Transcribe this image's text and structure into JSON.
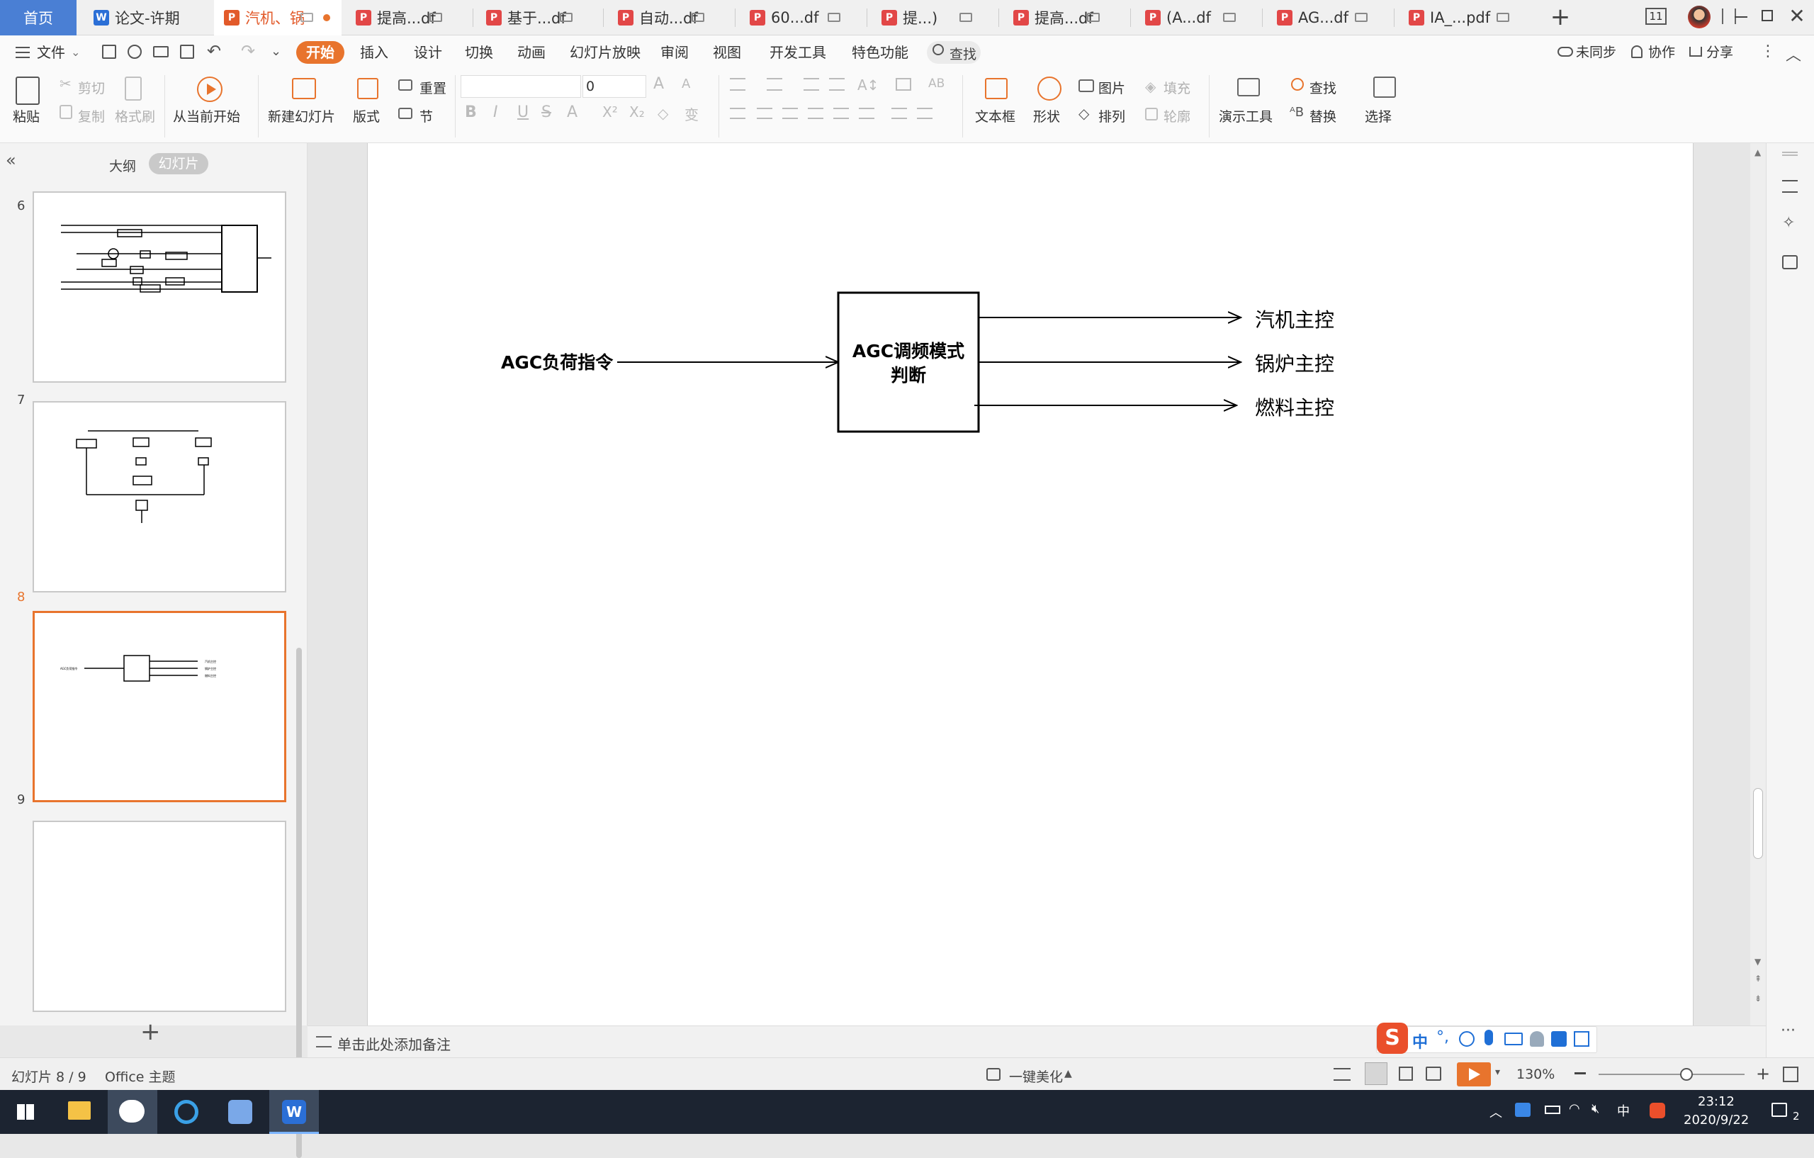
{
  "tabs": [
    {
      "label": "首页",
      "icon": "home",
      "active": false
    },
    {
      "label": "论文-许期",
      "icon": "word-doc-icon"
    },
    {
      "label": "汽机、锅",
      "icon": "ppt-icon",
      "active": true
    },
    {
      "label": "提高...df",
      "icon": "pdf-icon"
    },
    {
      "label": "基于...df",
      "icon": "pdf-icon"
    },
    {
      "label": "自动...df",
      "icon": "pdf-icon"
    },
    {
      "label": "60...df",
      "icon": "pdf-icon"
    },
    {
      "label": "提...)",
      "icon": "pdf-icon"
    },
    {
      "label": "提高...df",
      "icon": "pdf-icon"
    },
    {
      "label": "(A...df",
      "icon": "pdf-icon"
    },
    {
      "label": "AG...df",
      "icon": "pdf-icon"
    },
    {
      "label": "IA_...pdf",
      "icon": "pdf-icon"
    }
  ],
  "window": {
    "page_count_badge": "11"
  },
  "menu": {
    "file": "文件",
    "items": [
      "开始",
      "插入",
      "设计",
      "切换",
      "动画",
      "幻灯片放映",
      "审阅",
      "视图",
      "开发工具",
      "特色功能"
    ],
    "active": "开始",
    "search": "查找",
    "sync": "未同步",
    "collab": "协作",
    "share": "分享"
  },
  "ribbon": {
    "paste": "粘贴",
    "cut": "剪切",
    "copy": "复制",
    "format_painter": "格式刷",
    "from_current": "从当前开始",
    "new_slide": "新建幻灯片",
    "layout": "版式",
    "reset": "重置",
    "section": "节",
    "font_size_value": "0",
    "textbox": "文本框",
    "shape": "形状",
    "picture": "图片",
    "fill": "填充",
    "arrange": "排列",
    "outline": "轮廓",
    "present_tools": "演示工具",
    "find": "查找",
    "replace": "替换",
    "select": "选择"
  },
  "leftpanel": {
    "tab_outline": "大纲",
    "tab_slides": "幻灯片",
    "slide_numbers": [
      "6",
      "7",
      "8",
      "9"
    ],
    "selected": "8"
  },
  "slide": {
    "input_label": "AGC负荷指令",
    "block_line1": "AGC调频模式",
    "block_line2": "判断",
    "outputs": [
      "汽机主控",
      "锅炉主控",
      "燃料主控"
    ]
  },
  "notes": {
    "placeholder": "单击此处添加备注"
  },
  "status": {
    "slide_pos": "幻灯片 8 / 9",
    "theme": "Office 主题",
    "beautify": "一键美化",
    "zoom": "130%",
    "zoom_fraction": 0.6
  },
  "ime": {
    "lang": "中"
  },
  "taskbar": {
    "time": "23:12",
    "date": "2020/9/22",
    "ime_lang": "中",
    "notif_count": "2"
  }
}
